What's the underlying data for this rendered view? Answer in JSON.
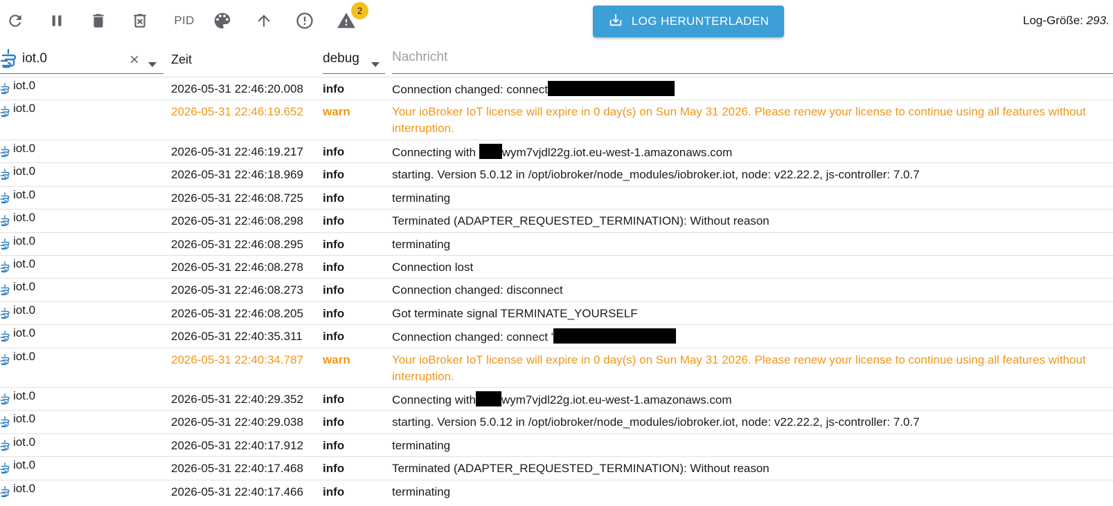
{
  "toolbar": {
    "pid_label": "PID",
    "warnings_badge": "2",
    "download_label": "LOG HERUNTERLADEN",
    "log_size_label": "Log-Größe: ",
    "log_size_value": "293.",
    "icons": [
      "refresh-icon",
      "pause-icon",
      "delete-icon",
      "delete-log-icon",
      "palette-icon",
      "arrow-up-icon",
      "error-icon",
      "warning-icon",
      "download-icon"
    ]
  },
  "filters": {
    "source_value": "iot.0",
    "time_header": "Zeit",
    "level_value": "debug",
    "message_placeholder": "Nachricht"
  },
  "colors": {
    "accent": "#3d9fd8",
    "warn": "#f0961a",
    "badge": "#f5bf1e",
    "adapter_icon": "#2f7fc1"
  },
  "rows": [
    {
      "src": "iot.0",
      "time": "2026-05-31 22:46:20.008",
      "level": "info",
      "type": "info",
      "pre": "Connection changed: connect",
      "redact": 183,
      "post": ""
    },
    {
      "src": "iot.0",
      "time": "2026-05-31 22:46:19.652",
      "level": "warn",
      "type": "warn",
      "pre": "Your ioBroker IoT license will expire in 0 day(s) on Sun May 31 2026. Please renew your license to continue using all features without interruption.",
      "redact": 0,
      "post": ""
    },
    {
      "src": "iot.0",
      "time": "2026-05-31 22:46:19.217",
      "level": "info",
      "type": "info",
      "pre": "Connecting with ",
      "redact": 33,
      "post": "wym7vjdl22g.iot.eu-west-1.amazonaws.com"
    },
    {
      "src": "iot.0",
      "time": "2026-05-31 22:46:18.969",
      "level": "info",
      "type": "info",
      "pre": "starting. Version 5.0.12 in /opt/iobroker/node_modules/iobroker.iot, node: v22.22.2, js-controller: 7.0.7",
      "redact": 0,
      "post": ""
    },
    {
      "src": "iot.0",
      "time": "2026-05-31 22:46:08.725",
      "level": "info",
      "type": "info",
      "pre": "terminating",
      "redact": 0,
      "post": ""
    },
    {
      "src": "iot.0",
      "time": "2026-05-31 22:46:08.298",
      "level": "info",
      "type": "info",
      "pre": "Terminated (ADAPTER_REQUESTED_TERMINATION): Without reason",
      "redact": 0,
      "post": ""
    },
    {
      "src": "iot.0",
      "time": "2026-05-31 22:46:08.295",
      "level": "info",
      "type": "info",
      "pre": "terminating",
      "redact": 0,
      "post": ""
    },
    {
      "src": "iot.0",
      "time": "2026-05-31 22:46:08.278",
      "level": "info",
      "type": "info",
      "pre": "Connection lost",
      "redact": 0,
      "post": ""
    },
    {
      "src": "iot.0",
      "time": "2026-05-31 22:46:08.273",
      "level": "info",
      "type": "info",
      "pre": "Connection changed: disconnect",
      "redact": 0,
      "post": ""
    },
    {
      "src": "iot.0",
      "time": "2026-05-31 22:46:08.205",
      "level": "info",
      "type": "info",
      "pre": "Got terminate signal TERMINATE_YOURSELF",
      "redact": 0,
      "post": ""
    },
    {
      "src": "iot.0",
      "time": "2026-05-31 22:40:35.311",
      "level": "info",
      "type": "info",
      "pre": "Connection changed: connect '",
      "redact": 177,
      "post": ""
    },
    {
      "src": "iot.0",
      "time": "2026-05-31 22:40:34.787",
      "level": "warn",
      "type": "warn",
      "pre": "Your ioBroker IoT license will expire in 0 day(s) on Sun May 31 2026. Please renew your license to continue using all features without interruption.",
      "redact": 0,
      "post": ""
    },
    {
      "src": "iot.0",
      "time": "2026-05-31 22:40:29.352",
      "level": "info",
      "type": "info",
      "pre": "Connecting with",
      "redact": 37,
      "post": "wym7vjdl22g.iot.eu-west-1.amazonaws.com"
    },
    {
      "src": "iot.0",
      "time": "2026-05-31 22:40:29.038",
      "level": "info",
      "type": "info",
      "pre": "starting. Version 5.0.12 in /opt/iobroker/node_modules/iobroker.iot, node: v22.22.2, js-controller: 7.0.7",
      "redact": 0,
      "post": ""
    },
    {
      "src": "iot.0",
      "time": "2026-05-31 22:40:17.912",
      "level": "info",
      "type": "info",
      "pre": "terminating",
      "redact": 0,
      "post": ""
    },
    {
      "src": "iot.0",
      "time": "2026-05-31 22:40:17.468",
      "level": "info",
      "type": "info",
      "pre": "Terminated (ADAPTER_REQUESTED_TERMINATION): Without reason",
      "redact": 0,
      "post": ""
    },
    {
      "src": "iot.0",
      "time": "2026-05-31 22:40:17.466",
      "level": "info",
      "type": "info",
      "pre": "terminating",
      "redact": 0,
      "post": ""
    }
  ]
}
